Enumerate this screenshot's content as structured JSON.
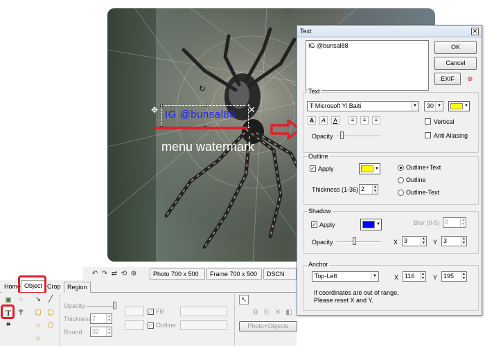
{
  "canvas": {
    "watermark_text": "IG @bunsal88",
    "annotation_text": "menu watermark"
  },
  "status_bar": {
    "photo_size": "Photo 700 x 500",
    "frame_size": "Frame 700 x 500",
    "filename": "DSCN"
  },
  "tabs": [
    {
      "label": "Home"
    },
    {
      "label": "Object",
      "active": true
    },
    {
      "label": "Crop"
    },
    {
      "label": "Region"
    }
  ],
  "object_panel": {
    "opacity_label": "Opacity",
    "thickness_label": "Thickness",
    "thickness_value": "2",
    "round_label": "Round",
    "round_value": "32",
    "fill_label": "Fill",
    "outline_label": "Outline",
    "photo_objects_label": "Photo+Objects"
  },
  "dialog": {
    "title": "Text",
    "text_value": "IG @bunsal88",
    "ok_label": "OK",
    "cancel_label": "Cancel",
    "exif_label": "EXIF",
    "text_group": {
      "label": "Text",
      "font_name": "Microsoft Yi Baiti",
      "font_size": "30",
      "text_color": "#ffff00",
      "opacity_label": "Opacity",
      "vertical_label": "Vertical",
      "antialias_label": "Anti Aliasing"
    },
    "outline_group": {
      "label": "Outline",
      "apply_label": "Apply",
      "color": "#ffff00",
      "thickness_label": "Thickness (1-36)",
      "thickness_value": "2",
      "options": [
        "Outline+Text",
        "Outline",
        "Outline-Text"
      ],
      "selected_option": "Outline+Text"
    },
    "shadow_group": {
      "label": "Shadow",
      "apply_label": "Apply",
      "color": "#0000ff",
      "blur_label": "Blur (0-5)",
      "blur_value": "0",
      "opacity_label": "Opacity",
      "x_label": "X",
      "x_value": "3",
      "y_label": "Y",
      "y_value": "3"
    },
    "anchor_group": {
      "label": "Anchor",
      "position": "Top-Left",
      "x_label": "X",
      "x_value": "116",
      "y_label": "Y",
      "y_value": "195",
      "note_line1": "If coordinates are out of range,",
      "note_line2": "Please reset X and Y."
    }
  }
}
